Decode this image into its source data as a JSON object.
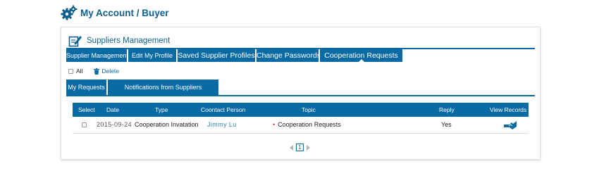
{
  "page": {
    "title": "My Account / Buyer",
    "icon": "gears-icon"
  },
  "panel": {
    "title": "Suppliers Management",
    "icon": "edit-icon"
  },
  "main_tabs": [
    {
      "label": "Supplier Management"
    },
    {
      "label": "Edit My Profile"
    },
    {
      "label": "Saved Supplier Profiles"
    },
    {
      "label": "Change Passwords"
    },
    {
      "label": "Cooperation Requests",
      "active": true
    }
  ],
  "actions": {
    "all_label": "All",
    "delete_label": "Delete"
  },
  "sub_tabs": [
    {
      "label": "My Requests",
      "active": true
    },
    {
      "label": "Notifications from Suppliers"
    }
  ],
  "table": {
    "headers": [
      "Select",
      "Date",
      "Type",
      "Coontact Person",
      "Topic",
      "Reply",
      "View Records"
    ],
    "rows": [
      {
        "date": "2015-09-24",
        "type": "Cooperation Invatation",
        "person": "Jimmy Lu",
        "topic": "Cooperation Requests",
        "reply": "Yes"
      }
    ]
  },
  "pagination": {
    "current": "1"
  },
  "colors": {
    "accent": "#0a6aa3",
    "title": "#0d5f8f",
    "link": "#2a86b9",
    "bullet": "#dd3333"
  }
}
